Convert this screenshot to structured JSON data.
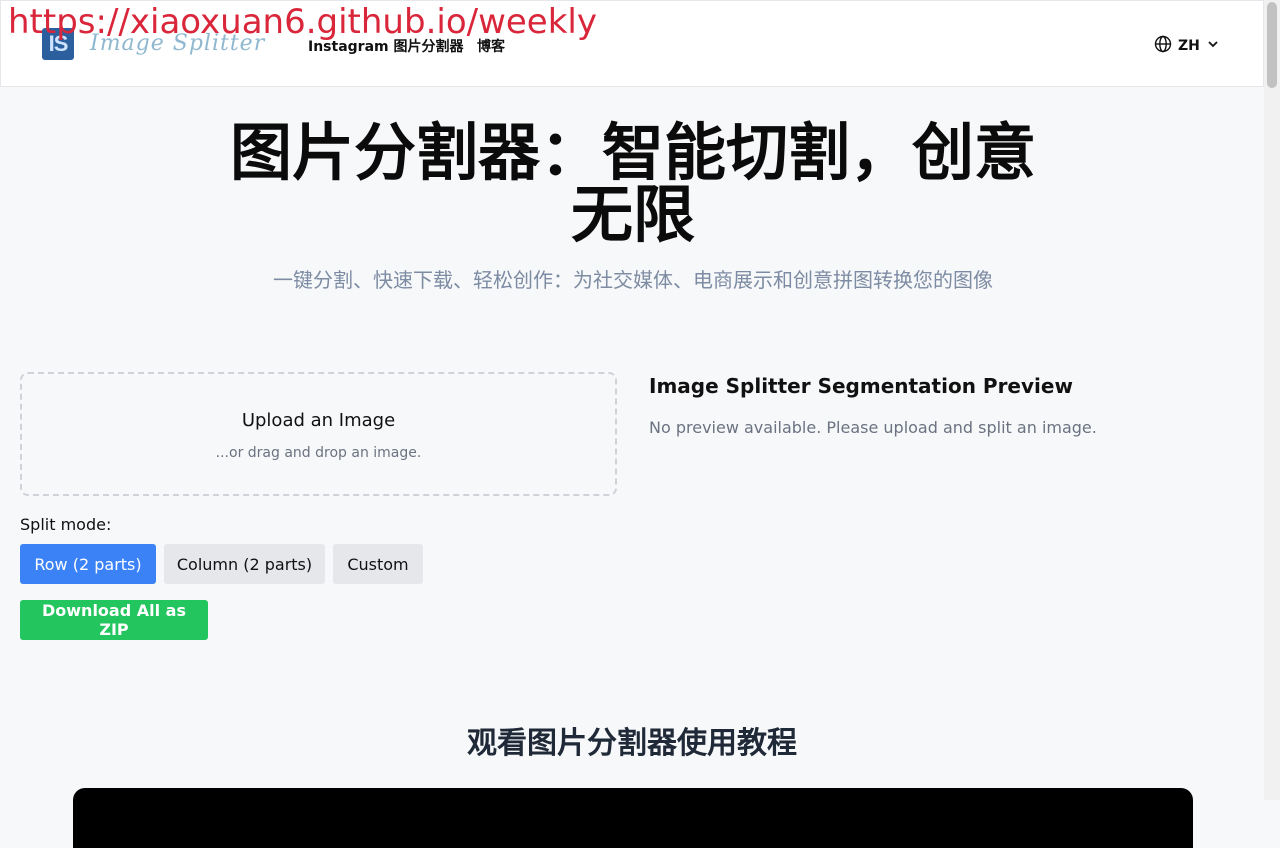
{
  "overlay": {
    "url": "https://xiaoxuan6.github.io/weekly"
  },
  "header": {
    "logo_mark": "IS",
    "logo_text": "Image Splitter",
    "nav": [
      {
        "label": "Instagram 图片分割器"
      },
      {
        "label": "博客"
      }
    ],
    "language": "ZH",
    "icons": {
      "language": "globe-icon",
      "dropdown": "chevron-down-icon"
    }
  },
  "hero": {
    "title": "图片分割器：智能切割，创意无限",
    "subtitle": "一键分割、快速下载、轻松创作：为社交媒体、电商展示和创意拼图转换您的图像"
  },
  "upload": {
    "title": "Upload an Image",
    "hint": "...or drag and drop an image."
  },
  "split_mode": {
    "label": "Split mode:",
    "options": [
      {
        "label": "Row (2 parts)",
        "selected": true
      },
      {
        "label": "Column (2 parts)",
        "selected": false
      },
      {
        "label": "Custom",
        "selected": false
      }
    ]
  },
  "download": {
    "label": "Download All as ZIP"
  },
  "preview": {
    "title": "Image Splitter Segmentation Preview",
    "empty": "No preview available. Please upload and split an image."
  },
  "tutorial": {
    "title": "观看图片分割器使用教程"
  },
  "colors": {
    "accent_blue": "#3b82f6",
    "success_green": "#22c55e",
    "overlay_red": "#d9263a"
  }
}
